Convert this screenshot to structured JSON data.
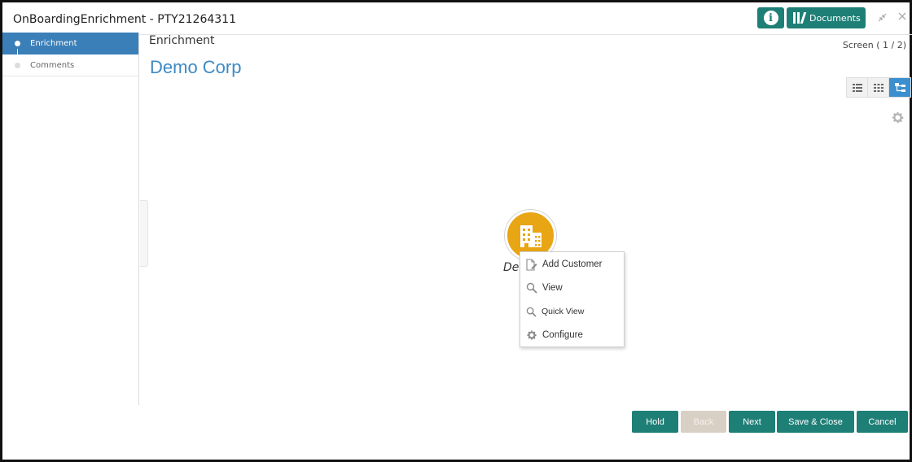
{
  "window": {
    "title": "OnBoardingEnrichment - PTY21264311",
    "documents_label": "Documents",
    "info_icon": "info-icon",
    "minimize_icon": "minimize-icon",
    "close_icon": "close-icon"
  },
  "sidebar": {
    "items": [
      {
        "label": "Enrichment",
        "active": true
      },
      {
        "label": "Comments",
        "active": false
      }
    ]
  },
  "main": {
    "section_title": "Enrichment",
    "screen_indicator": "Screen ( 1 / 2)",
    "company_name": "Demo Corp",
    "view_modes": [
      "list-view-icon",
      "grid-view-icon",
      "tree-view-icon"
    ],
    "active_view": "tree-view-icon"
  },
  "node": {
    "label": "Der",
    "icon": "building-icon",
    "color": "#e8a514"
  },
  "context_menu": {
    "items": [
      {
        "label": "Add Customer",
        "icon": "add-document-icon"
      },
      {
        "label": "View",
        "icon": "search-icon"
      },
      {
        "label": "Quick View",
        "icon": "search-icon"
      },
      {
        "label": "Configure",
        "icon": "gear-icon"
      }
    ]
  },
  "footer": {
    "hold": "Hold",
    "back": "Back",
    "next": "Next",
    "save_close": "Save & Close",
    "cancel": "Cancel"
  },
  "colors": {
    "primary": "#1e7f76",
    "sidebar_active": "#3b7fb8",
    "company_text": "#3e8ac4",
    "disabled": "#d9d0c5"
  }
}
